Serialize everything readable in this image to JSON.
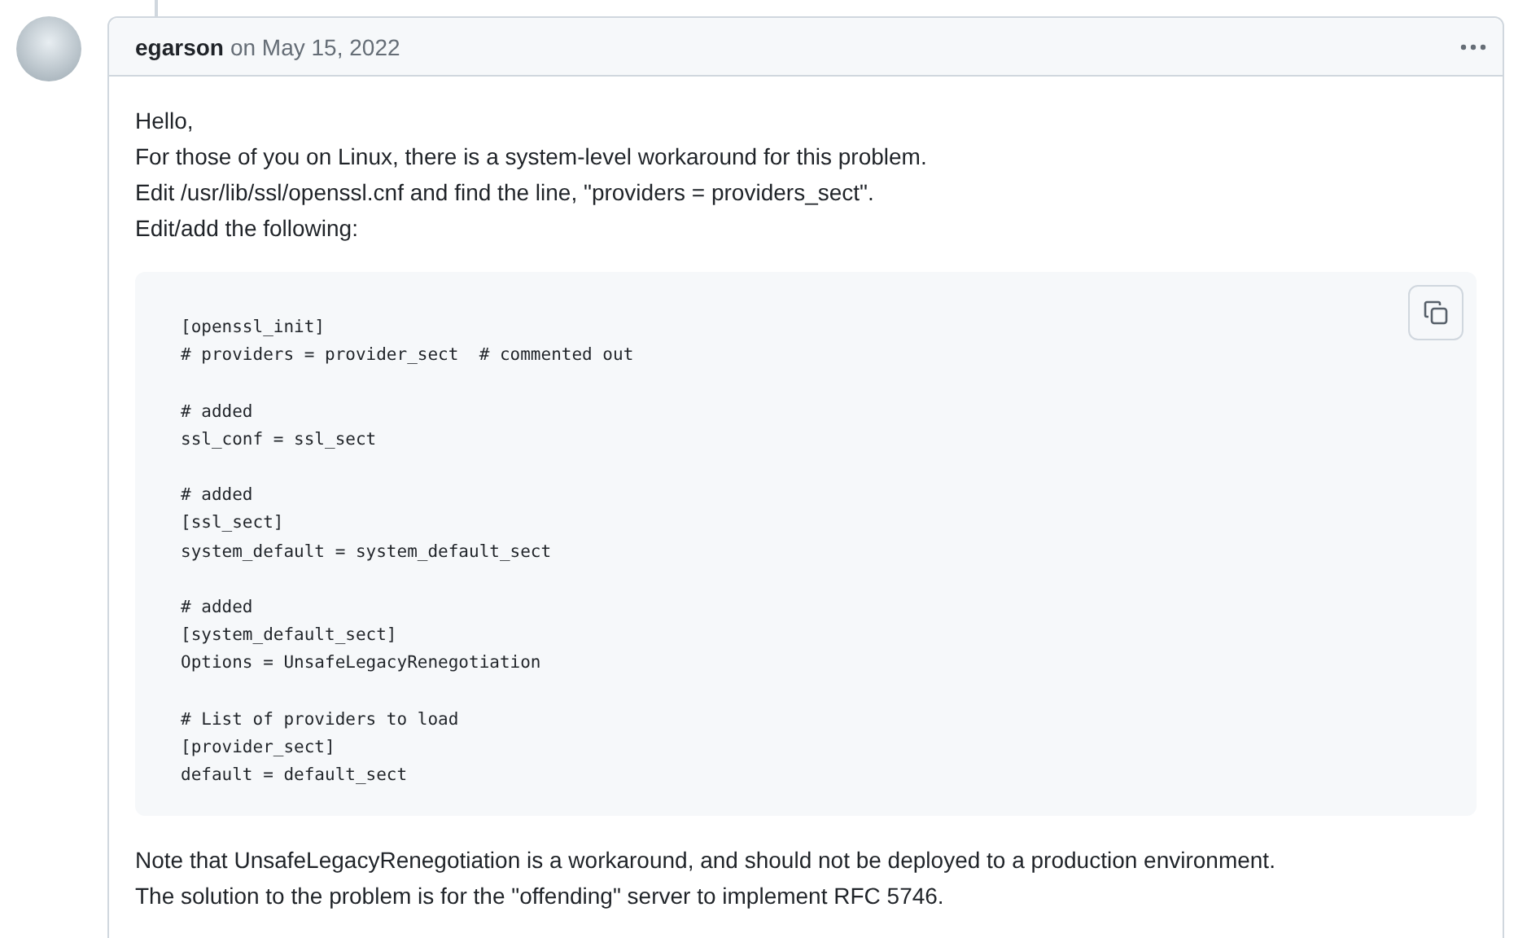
{
  "comment": {
    "author": "egarson",
    "date": "on May 15, 2022",
    "intro": [
      "Hello,",
      "For those of you on Linux, there is a system-level workaround for this problem.",
      "Edit /usr/lib/ssl/openssl.cnf and find the line, \"providers = providers_sect\".",
      "Edit/add the following:"
    ],
    "code": "[openssl_init]\n# providers = provider_sect  # commented out\n\n# added\nssl_conf = ssl_sect\n\n# added\n[ssl_sect]\nsystem_default = system_default_sect\n\n# added\n[system_default_sect]\nOptions = UnsafeLegacyRenegotiation\n\n# List of providers to load\n[provider_sect]\ndefault = default_sect",
    "outro": [
      "Note that UnsafeLegacyRenegotiation is a workaround, and should not be deployed to a production environment.",
      "The solution to the problem is for the \"offending\" server to implement RFC 5746."
    ]
  }
}
